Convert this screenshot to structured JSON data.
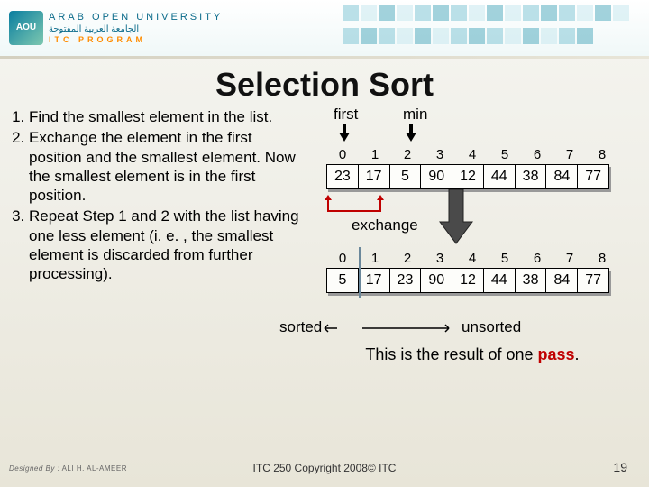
{
  "header": {
    "logo_initials": "AOU",
    "uni_en": "ARAB OPEN UNIVERSITY",
    "uni_ar": "الجامعة العربية المفتوحة",
    "program": "ITC PROGRAM"
  },
  "title": "Selection Sort",
  "steps": [
    "Find the smallest element in the list.",
    "Exchange the element in the first position and the smallest element. Now the smallest element is in the first position.",
    "Repeat Step 1 and 2 with the list having one less element (i. e. , the smallest element is discarded from further processing)."
  ],
  "diagram": {
    "first_label": "first",
    "min_label": "min",
    "indices": [
      "0",
      "1",
      "2",
      "3",
      "4",
      "5",
      "6",
      "7",
      "8"
    ],
    "values_before": [
      "23",
      "17",
      "5",
      "90",
      "12",
      "44",
      "38",
      "84",
      "77"
    ],
    "exchange_label": "exchange",
    "values_after": [
      "5",
      "17",
      "23",
      "90",
      "12",
      "44",
      "38",
      "84",
      "77"
    ],
    "sorted_label": "sorted",
    "unsorted_label": "unsorted",
    "pass_text_prefix": "This is the result of one ",
    "pass_word": "pass",
    "pass_suffix": "."
  },
  "footer": {
    "copyright": "ITC 250 Copyright 2008© ITC",
    "slide_number": "19",
    "designed_label": "Designed By :",
    "designer": "ALI H. AL-AMEER"
  }
}
